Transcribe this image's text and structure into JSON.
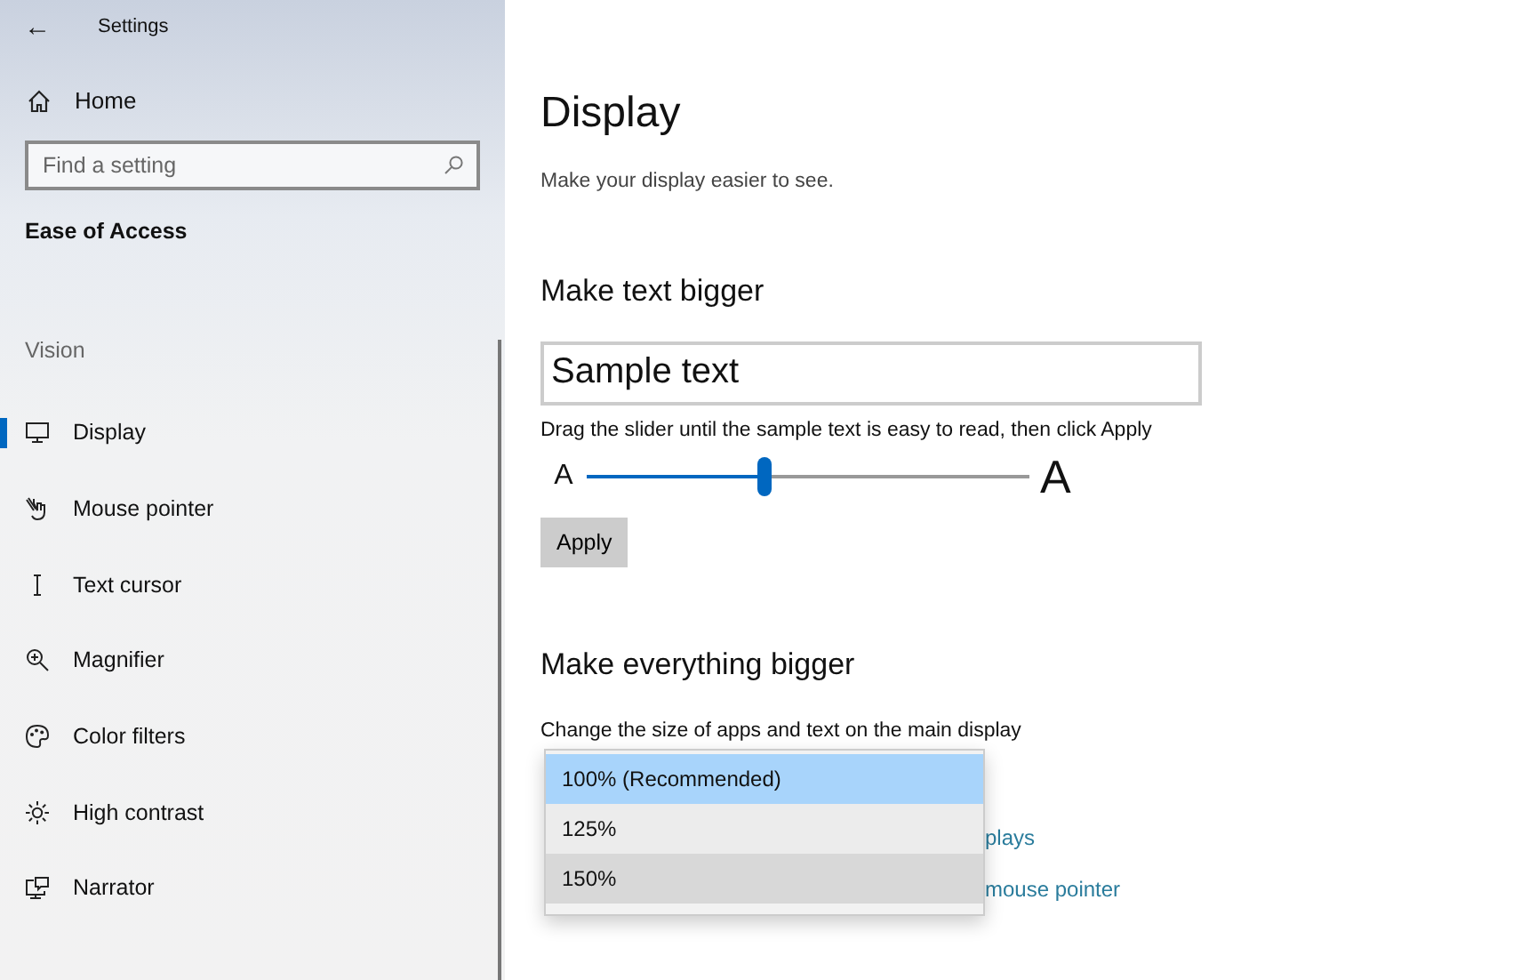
{
  "window": {
    "title": "Settings",
    "back": "←"
  },
  "sidebar": {
    "home": "Home",
    "search": {
      "placeholder": "Find a setting"
    },
    "category": "Ease of Access",
    "group": "Vision",
    "items": [
      {
        "label": "Display",
        "kind": "monitor",
        "selected": true
      },
      {
        "label": "Mouse pointer",
        "kind": "pointer",
        "selected": false
      },
      {
        "label": "Text cursor",
        "kind": "cursor",
        "selected": false
      },
      {
        "label": "Magnifier",
        "kind": "magnifier",
        "selected": false
      },
      {
        "label": "Color filters",
        "kind": "palette",
        "selected": false
      },
      {
        "label": "High contrast",
        "kind": "sun",
        "selected": false
      },
      {
        "label": "Narrator",
        "kind": "narrator",
        "selected": false
      }
    ]
  },
  "main": {
    "title": "Display",
    "subtitle": "Make your display easier to see.",
    "text_section": {
      "heading": "Make text bigger",
      "sample": "Sample text",
      "hint": "Drag the slider until the sample text is easy to read, then click Apply",
      "small_a": "A",
      "large_a": "A",
      "slider": {
        "level": 0.4
      },
      "apply": "Apply"
    },
    "everything_section": {
      "heading": "Make everything bigger",
      "hint": "Change the size of apps and text on the main display",
      "dropdown_options": [
        {
          "label": "100% (Recommended)",
          "selected": true,
          "hovered": false
        },
        {
          "label": "125%",
          "selected": false,
          "hovered": false
        },
        {
          "label": "150%",
          "selected": false,
          "hovered": true
        }
      ],
      "links": [
        "plays",
        "mouse pointer"
      ]
    }
  }
}
